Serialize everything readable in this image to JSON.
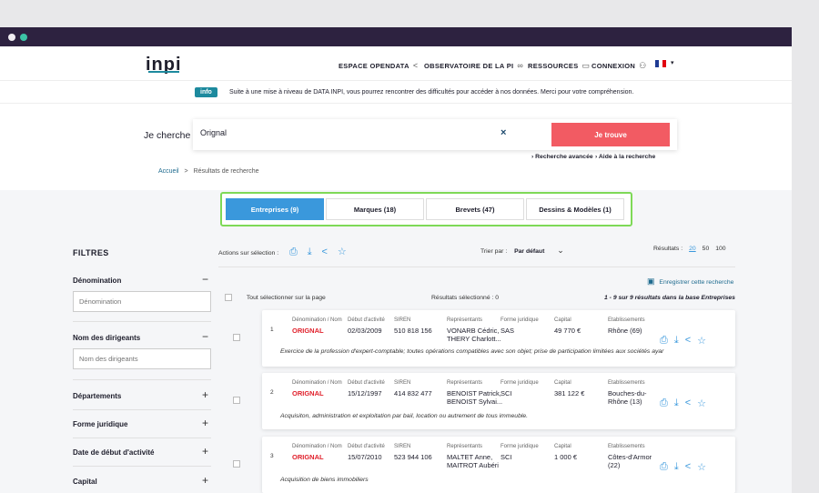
{
  "header": {
    "logo": "INPI",
    "nav": [
      {
        "label": "ESPACE OPENDATA",
        "icon": "share-icon"
      },
      {
        "label": "OBSERVATOIRE DE LA PI",
        "icon": "binoculars-icon"
      },
      {
        "label": "RESSOURCES",
        "icon": "folder-icon"
      },
      {
        "label": "CONNEXION",
        "icon": "user-icon"
      }
    ],
    "flag_colors": [
      "#1f3a93",
      "#ffffff",
      "#e1000f"
    ]
  },
  "info": {
    "badge": "info",
    "text": "Suite à une mise à niveau de DATA INPI, vous pourrez rencontrer des difficultés pour accéder à nos données. Merci pour votre compréhension."
  },
  "search": {
    "label": "Je cherche",
    "value": "Orignal",
    "clear": "×",
    "button": "Je trouve",
    "advanced": "› Recherche avancée",
    "help": "› Aide à la recherche"
  },
  "breadcrumb": {
    "home": "Accueil",
    "sep": ">",
    "current": "Résultats de recherche"
  },
  "tabs": [
    {
      "label": "Entreprises (9)",
      "active": true
    },
    {
      "label": "Marques (18)",
      "active": false
    },
    {
      "label": "Brevets (47)",
      "active": false
    },
    {
      "label": "Dessins & Modèles (1)",
      "active": false
    }
  ],
  "filters": {
    "title": "FILTRES",
    "denomination": {
      "label": "Dénomination",
      "placeholder": "Dénomination"
    },
    "dirigeants": {
      "label": "Nom des dirigeants",
      "placeholder": "Nom des dirigeants"
    },
    "departements": "Départements",
    "forme": "Forme juridique",
    "date": "Date de début d'activité",
    "capital": "Capital"
  },
  "toolbar": {
    "actions_label": "Actions sur sélection :",
    "sort_label": "Trier par :",
    "sort_value": "Par défaut",
    "results_label": "Résultats :",
    "page_sizes": [
      "20",
      "50",
      "100"
    ],
    "save": "Enregistrer cette recherche",
    "select_all": "Tout sélectionner sur la page",
    "selected": "Résultats sélectionné : 0",
    "count": "1 - 9 sur 9 résultats dans la base Entreprises"
  },
  "columns": [
    "Dénomination / Nom",
    "Début d'activité",
    "SIREN",
    "Représentants",
    "Forme juridique",
    "Capital",
    "Etablissements"
  ],
  "results": [
    {
      "num": "1",
      "name": "ORIGNAL",
      "date": "02/03/2009",
      "siren": "510 818 156",
      "rep1": "VONARB Cédric,",
      "rep2": "THERY Charlott...",
      "forme": "SAS",
      "capital": "49 770 €",
      "etab1": "Rhône (69)",
      "etab2": "",
      "desc": "Exercice de la profession d'expert-comptable; toutes opérations compatibles avec son objet; prise de participation limitées aux sociétés ayar"
    },
    {
      "num": "2",
      "name": "ORIGNAL",
      "date": "15/12/1997",
      "siren": "414 832 477",
      "rep1": "BENOIST Patrick,",
      "rep2": "BENOIST Sylvai...",
      "forme": "SCI",
      "capital": "381 122 €",
      "etab1": "Bouches-du-",
      "etab2": "Rhône (13)",
      "desc": "Acquisiton, administration et exploitation par bail, location ou autrement de tous immeuble."
    },
    {
      "num": "3",
      "name": "ORIGNAL",
      "date": "15/07/2010",
      "siren": "523 944 106",
      "rep1": "MALTET Anne,",
      "rep2": "MAITROT Aubéri",
      "forme": "SCI",
      "capital": "1 000 €",
      "etab1": "Côtes-d'Armor",
      "etab2": "(22)",
      "desc": "Acquisition de biens immobiliers"
    }
  ]
}
